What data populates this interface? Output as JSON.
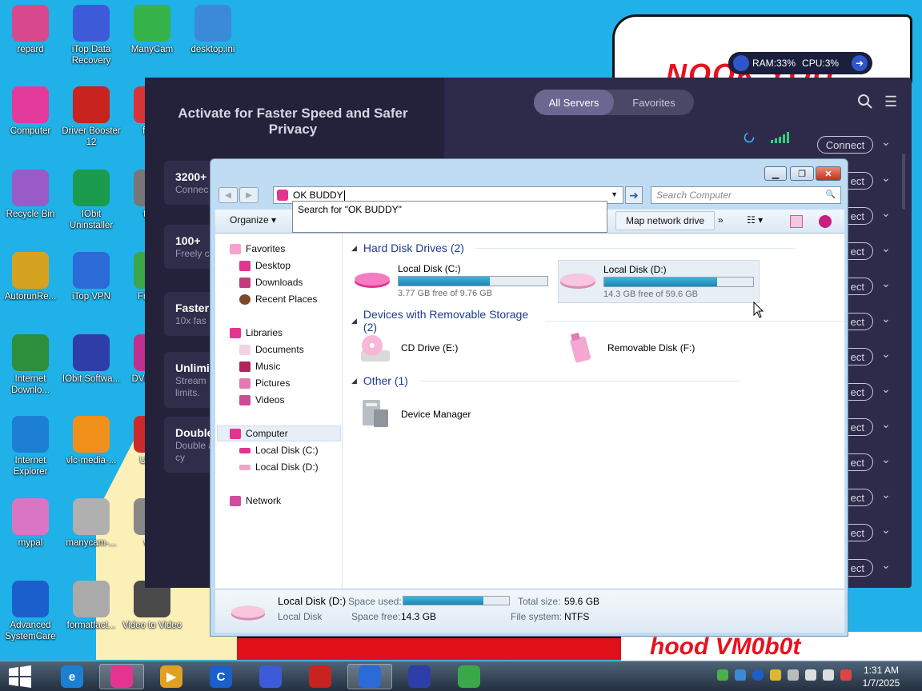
{
  "desktop_icons": [
    {
      "label": "repard",
      "color": "#d7488f"
    },
    {
      "label": "iTop Data Recovery",
      "color": "#3d5bd8"
    },
    {
      "label": "ManyCam",
      "color": "#36b34a"
    },
    {
      "label": "desktop.ini",
      "color": "#3a8ad8"
    },
    {
      "label": "Computer",
      "color": "#e33a9e"
    },
    {
      "label": "Driver Booster 12",
      "color": "#c8231e"
    },
    {
      "label": "free-",
      "color": "#d9333a"
    },
    {
      "label": "Recycle Bin",
      "color": "#9a5bc9"
    },
    {
      "label": "IObit Uninstaller",
      "color": "#1a9b4d"
    },
    {
      "label": "total",
      "color": "#777"
    },
    {
      "label": "AutorunRe...",
      "color": "#d6a321"
    },
    {
      "label": "iTop VPN",
      "color": "#2c6ad8"
    },
    {
      "label": "Fre Vic",
      "color": "#3aa848"
    },
    {
      "label": "Internet Downlo...",
      "color": "#2d8e3c"
    },
    {
      "label": "IObit Softwa...",
      "color": "#2e3ea8"
    },
    {
      "label": "DVD Free",
      "color": "#c0308e"
    },
    {
      "label": "Internet Explorer",
      "color": "#1d7fd2"
    },
    {
      "label": "vlc-media-...",
      "color": "#f0901b"
    },
    {
      "label": "USBE",
      "color": "#cc2a2a"
    },
    {
      "label": "mypal",
      "color": "#d876c4"
    },
    {
      "label": "manycam-...",
      "color": "#b0b0b0"
    },
    {
      "label": "vide",
      "color": "#888"
    },
    {
      "label": "Advanced SystemCare",
      "color": "#1a5fcc"
    },
    {
      "label": "formatfact...",
      "color": "#aaa"
    },
    {
      "label": "Video to Video",
      "color": "#4a4a4a"
    }
  ],
  "sysmon": {
    "ram": "RAM:33%",
    "cpu": "CPU:3%"
  },
  "wallpaper": {
    "top_text": "NOOK YOU",
    "bottom_text": "hood VM0b0t"
  },
  "vpn": {
    "title": "Activate for Faster Speed and Safer Privacy",
    "tabs": [
      {
        "label": "All Servers"
      },
      {
        "label": "Favorites"
      }
    ],
    "cards": [
      {
        "title": "3200+",
        "sub": "Connec"
      },
      {
        "title": "100+",
        "sub": "Freely c"
      },
      {
        "title": "Faster",
        "sub": "10x fas"
      },
      {
        "title": "Unlimi",
        "sub": "Stream limits."
      },
      {
        "title": "Double",
        "sub": "Double and cy"
      }
    ],
    "connect_label": "Connect",
    "connect_partial": "ect"
  },
  "explorer": {
    "address_value": "OK BUDDY",
    "search_placeholder": "Search Computer",
    "suggestion": "Search for \"OK BUDDY\"",
    "toolbar": {
      "organize": "Organize",
      "map_drive": "Map network drive",
      "more": "»"
    },
    "nav": {
      "favorites": "Favorites",
      "desktop": "Desktop",
      "downloads": "Downloads",
      "recent": "Recent Places",
      "libraries": "Libraries",
      "documents": "Documents",
      "music": "Music",
      "pictures": "Pictures",
      "videos": "Videos",
      "computer": "Computer",
      "disk_c": "Local Disk (C:)",
      "disk_d": "Local Disk (D:)",
      "network": "Network"
    },
    "groups": {
      "hdd": "Hard Disk Drives (2)",
      "removable": "Devices with Removable Storage (2)",
      "other": "Other (1)"
    },
    "drives": [
      {
        "name": "Local Disk (C:)",
        "free": "3.77 GB free of 9.76 GB",
        "used_fraction": 0.614
      },
      {
        "name": "Local Disk (D:)",
        "free": "14.3 GB free of 59.6 GB",
        "used_fraction": 0.76
      }
    ],
    "removable": [
      {
        "name": "CD Drive (E:)"
      },
      {
        "name": "Removable Disk (F:)"
      }
    ],
    "other": [
      {
        "name": "Device Manager"
      }
    ],
    "details": {
      "name": "Local Disk (D:)",
      "type": "Local Disk",
      "space_used_label": "Space used:",
      "space_free_label": "Space free:",
      "space_free": "14.3 GB",
      "total_size_label": "Total size:",
      "total_size": "59.6 GB",
      "fs_label": "File system:",
      "fs": "NTFS",
      "used_fraction": 0.76
    }
  },
  "clock": {
    "time": "1:31 AM",
    "date": "1/7/2025"
  }
}
